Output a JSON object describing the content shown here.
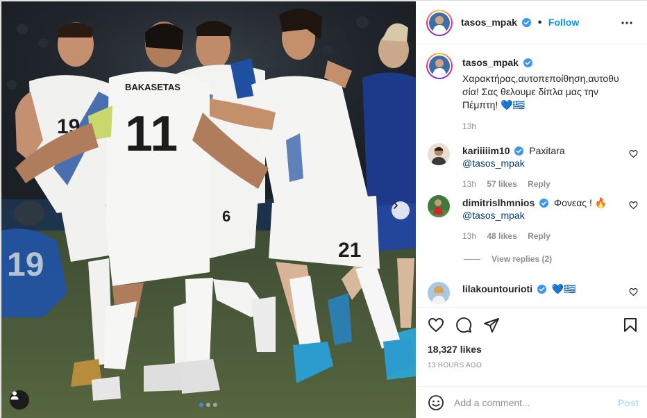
{
  "post": {
    "author": "tasos_mpak",
    "follow_label": "Follow",
    "separator": "•",
    "caption_line1": "Χαρακτήρας,αυτοπεποίθηση,αυτοθυ",
    "caption_line2": "σία! Σας θελουμε δίπλα μας την",
    "caption_line3": "Πέμπτη! 💙🇬🇷",
    "caption_time": "13h",
    "jersey_name": "BAKASETAS",
    "jersey_numbers": [
      "11",
      "19",
      "6",
      "21",
      "19"
    ]
  },
  "comments": [
    {
      "user": "kariiiiim10",
      "verified": true,
      "text": "Paxitara ",
      "mention": "@tasos_mpak",
      "time": "13h",
      "likes": "57 likes",
      "reply": "Reply"
    },
    {
      "user": "dimitrislhmnios",
      "verified": true,
      "text": "Φονεας ! 🔥",
      "mention": "@tasos_mpak",
      "time": "13h",
      "likes": "48 likes",
      "reply": "Reply"
    },
    {
      "user": "lilakountourioti",
      "verified": true,
      "text": "💙🇬🇷"
    }
  ],
  "view_replies": "View replies (2)",
  "stats": {
    "likes": "18,327 likes",
    "time_ago": "13 HOURS AGO"
  },
  "composer": {
    "placeholder": "Add a comment...",
    "post_label": "Post"
  },
  "carousel": {
    "slide_count": 3,
    "active_slide": 1
  },
  "colors": {
    "accent": "#0095f6",
    "verified": "#3897f0",
    "greece_blue": "#1f4fa0",
    "kosovo_blue": "#1d3a8a"
  },
  "icons": [
    "verified-badge-icon",
    "more-options-icon",
    "heart-icon",
    "comment-icon",
    "share-icon",
    "bookmark-icon",
    "emoji-icon",
    "chevron-right-icon",
    "user-tag-icon"
  ]
}
